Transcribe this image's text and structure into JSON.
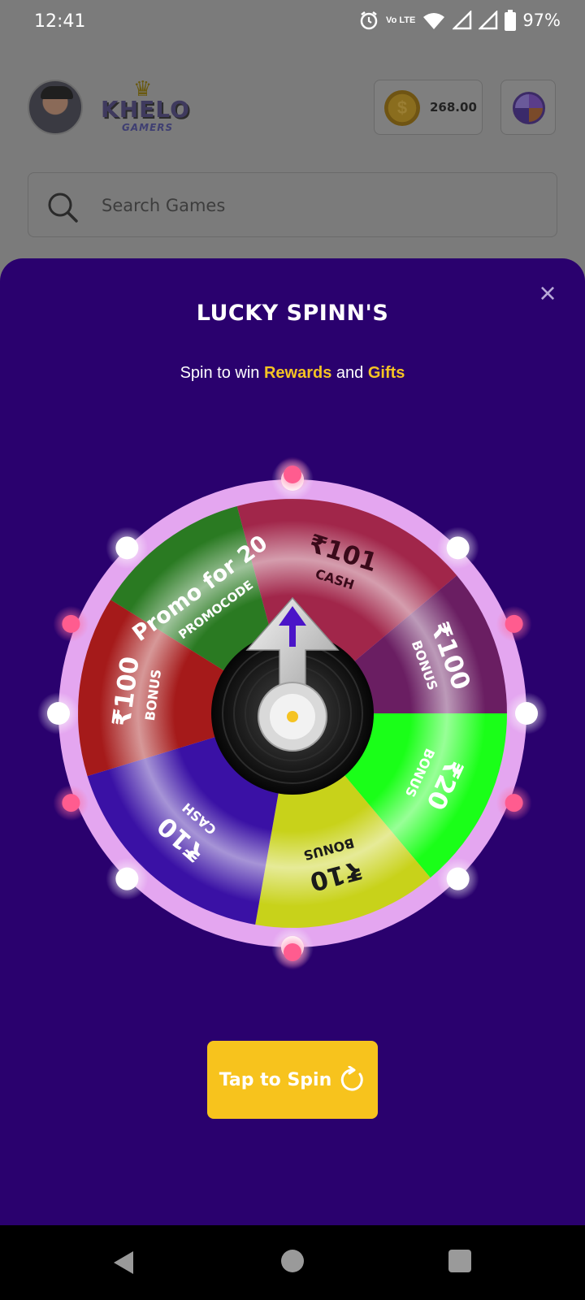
{
  "status_bar": {
    "time": "12:41",
    "network": "Vo LTE",
    "battery": "97%"
  },
  "header": {
    "brand_name": "KHELO",
    "brand_sub": "GAMERS",
    "coin_symbol": "$",
    "coins": "268.00"
  },
  "search": {
    "placeholder": "Search Games"
  },
  "spin_sheet": {
    "close_label": "×",
    "title": "LUCKY SPINN'S",
    "subtitle_prefix": "Spin to win",
    "subtitle_rewards": "Rewards",
    "subtitle_and": "and",
    "subtitle_gifts": "Gifts",
    "button_label": "Tap to Spin"
  },
  "wheel": {
    "segments": [
      {
        "amount": "₹101",
        "kind": "CASH",
        "color": "#a1264a"
      },
      {
        "amount": "₹100",
        "kind": "BONUS",
        "color": "#6a1e62"
      },
      {
        "amount": "₹20",
        "kind": "BONUS",
        "color": "#1aff18"
      },
      {
        "amount": "₹10",
        "kind": "BONUS",
        "color": "#c8d21a"
      },
      {
        "amount": "₹10",
        "kind": "CASH",
        "color": "#3a11a5"
      },
      {
        "amount": "₹100",
        "kind": "BONUS",
        "color": "#a51a1a"
      },
      {
        "amount": "Promo for 20",
        "kind": "PROMOCODE",
        "color": "#2a7a22"
      }
    ],
    "rim_color": "#e4a6f0",
    "pointer_arrow_color": "#4a14c8"
  },
  "colors": {
    "sheet_bg": "#2a016e",
    "accent": "#f5c323",
    "button_bg": "#f7c31d"
  }
}
